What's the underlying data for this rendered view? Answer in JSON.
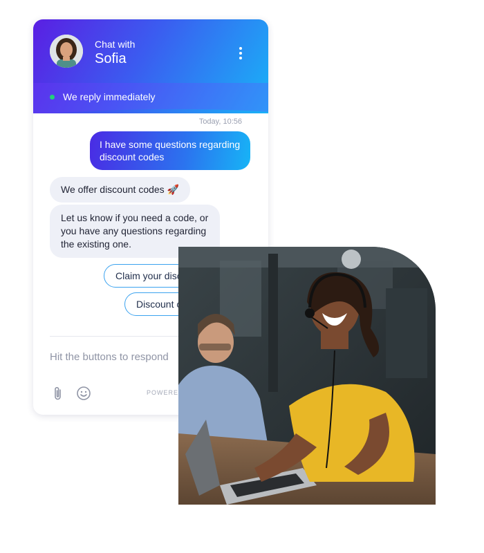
{
  "header": {
    "chat_with_label": "Chat with",
    "agent_name": "Sofia",
    "status_text": "We reply immediately"
  },
  "messages": {
    "timestamp": "Today, 10:56",
    "outgoing": "I have some questions regarding discount codes",
    "incoming_1": "We offer discount codes 🚀",
    "incoming_2": "Let us know if you need a code, or you have any questions regarding the existing one."
  },
  "quick_replies": [
    "Claim your disc",
    "Discount c"
  ],
  "composer": {
    "placeholder": "Hit the buttons to respond",
    "powered_label": "POWERED"
  },
  "icons": [
    "avatar",
    "menu-dots-icon",
    "status-dot",
    "attach-icon",
    "emoji-icon"
  ],
  "colors": {
    "header_gradient_start": "#5a1fe3",
    "header_gradient_end": "#19b3f7",
    "status_online": "#22d07a",
    "quick_reply_border": "#3aa2ef",
    "incoming_bubble": "#eef0f7"
  }
}
